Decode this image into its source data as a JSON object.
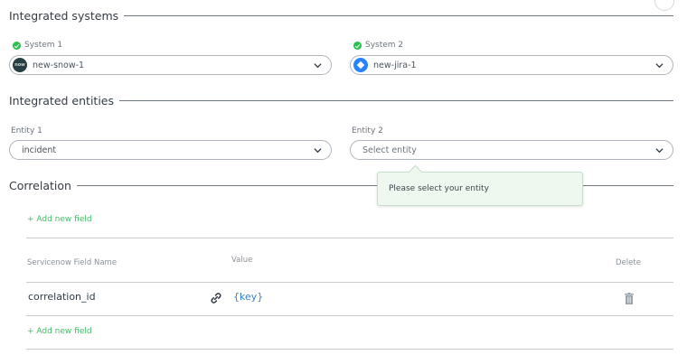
{
  "sections": {
    "integrated_systems": "Integrated systems",
    "integrated_entities": "Integrated entities",
    "correlation": "Correlation"
  },
  "systems": {
    "system1": {
      "label": "System 1",
      "value": "new-snow-1",
      "icon": "servicenow-icon",
      "icon_text": "now"
    },
    "system2": {
      "label": "System 2",
      "value": "new-jira-1",
      "icon": "jira-icon"
    }
  },
  "entities": {
    "entity1": {
      "label": "Entity 1",
      "value": "incident"
    },
    "entity2": {
      "label": "Entity 2",
      "placeholder": "Select entity"
    }
  },
  "tooltip": {
    "text": "Please select your entity"
  },
  "correlation": {
    "add_field_label": "+ Add new field",
    "headers": {
      "field": "Servicenow Field Name",
      "value": "Value",
      "delete": "Delete"
    },
    "rows": [
      {
        "field": "correlation_id",
        "value": "{key}"
      }
    ]
  },
  "colors": {
    "accent_green": "#3fbf63",
    "value_blue": "#3a7fc4",
    "status_green": "#27c24c"
  }
}
